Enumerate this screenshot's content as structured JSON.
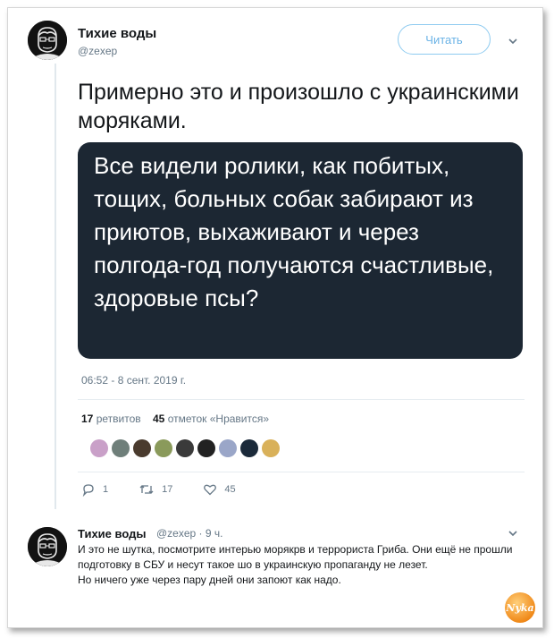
{
  "tweet": {
    "author_name": "Тихие воды",
    "author_handle": "@zexep",
    "follow_label": "Читать",
    "text": "Примерно это и произошло с украинскими моряками.",
    "image_text": "Все видели ролики, как побитых, тощих, больных собак забирают из приютов, выхаживают и через полгода-год получаются счастливые, здоровые псы?",
    "timestamp": "06:52 - 8 сент. 2019 г.",
    "retweets_count": "17",
    "retweets_label": "ретвитов",
    "likes_count": "45",
    "likes_label": "отметок «Нравится»",
    "reply_count": "1",
    "retweet_action_count": "17",
    "like_action_count": "45"
  },
  "likers": [
    {
      "color": "#c9a0c8"
    },
    {
      "color": "#6f7f7a"
    },
    {
      "color": "#4a3b2e"
    },
    {
      "color": "#8a9a5b"
    },
    {
      "color": "#3a3a3a"
    },
    {
      "color": "#222222"
    },
    {
      "color": "#9aa6c8"
    },
    {
      "color": "#1b2a3a"
    },
    {
      "color": "#d9b15a"
    }
  ],
  "reply": {
    "author_name": "Тихие воды",
    "meta": "@zexep · 9 ч.",
    "lines": [
      "И это не шутка, посмотрите интерью морякрв и террориста Гриба. Они ещё не прошли подготовку в СБУ и несут такое шо в украинскую пропаганду не лезет.",
      "Но ничего уже через пару дней они запоют как надо."
    ]
  },
  "watermark": {
    "text": "Nyka"
  }
}
